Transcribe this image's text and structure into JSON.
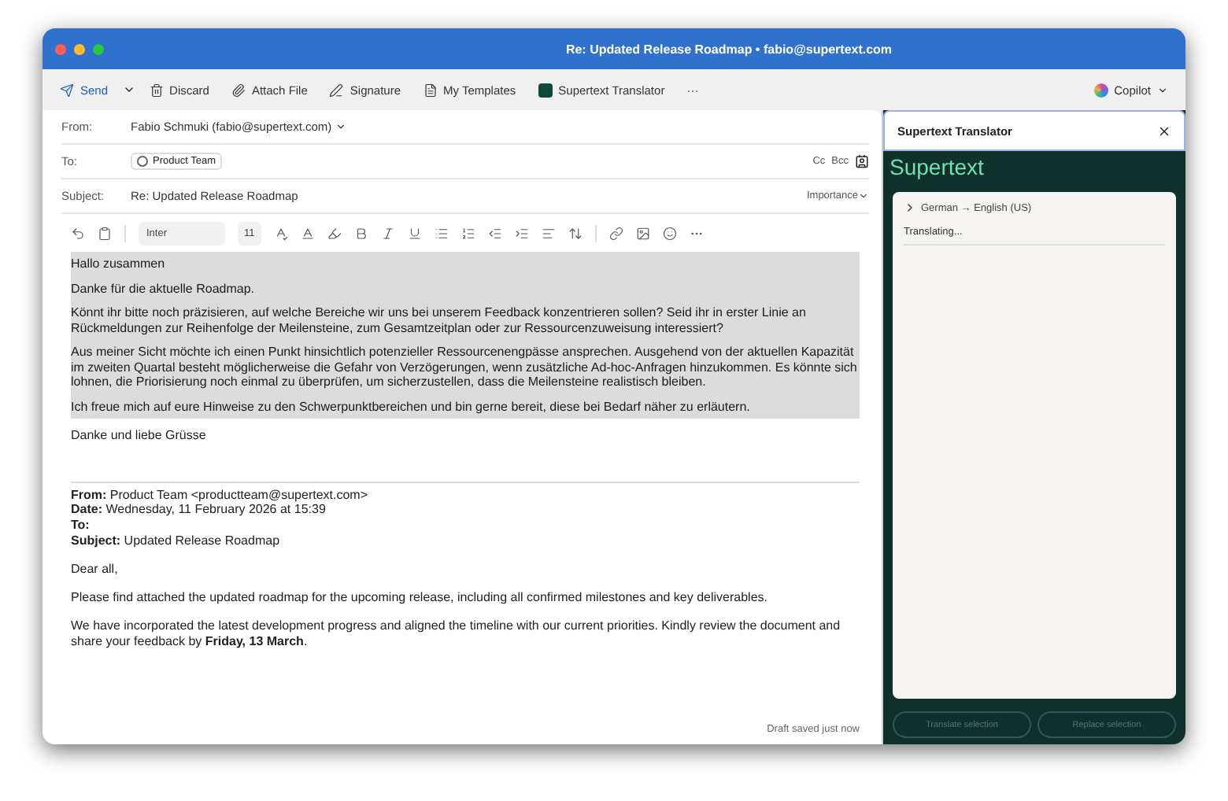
{
  "window": {
    "title": "Re: Updated Release Roadmap • fabio@supertext.com"
  },
  "toolbar": {
    "items": [
      {
        "label": "Send",
        "kind": "send"
      },
      {
        "label": "Discard",
        "kind": "plain"
      },
      {
        "label": "Attach File",
        "kind": "plain"
      },
      {
        "label": "Signature",
        "kind": "plain"
      },
      {
        "label": "My Templates",
        "kind": "plain"
      },
      {
        "label": "Supertext Translator",
        "kind": "addin"
      }
    ],
    "more": "···",
    "copilot": "Copilot"
  },
  "compose": {
    "from_label": "From:",
    "from_value": "Fabio Schmuki (fabio@supertext.com)",
    "to_label": "To:",
    "to_recipient": "Product Team",
    "cc": "Cc",
    "bcc": "Bcc",
    "subject_label": "Subject:",
    "subject_value": "Re: Updated Release Roadmap",
    "importance": "Importance"
  },
  "format_bar": {
    "font": "Inter",
    "size": "11"
  },
  "draft": {
    "highlighted": true,
    "paragraphs": [
      "Hallo zusammen",
      "Danke für die aktuelle Roadmap.",
      "Könnt ihr bitte noch präzisieren, auf welche Bereiche wir uns bei unserem Feedback konzentrieren sollen? Seid ihr in erster Linie an Rückmeldungen zur Reihenfolge der Meilensteine, zum Gesamtzeitplan oder zur Ressourcenzuweisung interessiert?",
      "Aus meiner Sicht möchte ich einen Punkt hinsichtlich potenzieller Ressourcenengpässe ansprechen. Ausgehend von der aktuellen Kapazität im zweiten Quartal besteht möglicherweise die Gefahr von Verzögerungen, wenn zusätzliche Ad-hoc-Anfragen hinzukommen. Es könnte sich lohnen, die Priorisierung noch einmal zu überprüfen, um sicherzustellen, dass die Meilensteine realistisch bleiben.",
      "Ich freue mich auf eure Hinweise zu den Schwerpunktbereichen und bin gerne bereit, diese bei Bedarf näher zu erläutern."
    ],
    "closing": "Danke und liebe Grüsse"
  },
  "quoted": {
    "headers": [
      {
        "label": "From:",
        "value": "Product Team <productteam@supertext.com>"
      },
      {
        "label": "Date:",
        "value": "Wednesday, 11 February 2026 at 15:39"
      },
      {
        "label": "To:"
      },
      {
        "label": "Subject:",
        "value": "Updated Release Roadmap"
      }
    ],
    "paragraphs": [
      "Dear all,",
      "Please find attached the updated roadmap for the upcoming release, including all confirmed milestones and key deliverables.",
      "We have incorporated the latest development progress and aligned the timeline with our current priorities. Kindly review the document and share your feedback by **Friday, 13 March**."
    ]
  },
  "status_bar": "Draft saved just now",
  "panel": {
    "title": "Supertext Translator",
    "brand": "Supertext",
    "language": "German → English (US)",
    "status": "Translating...",
    "buttons": [
      {
        "label": "Translate selection",
        "disabled": true
      },
      {
        "label": "Replace selection",
        "disabled": true
      }
    ]
  }
}
